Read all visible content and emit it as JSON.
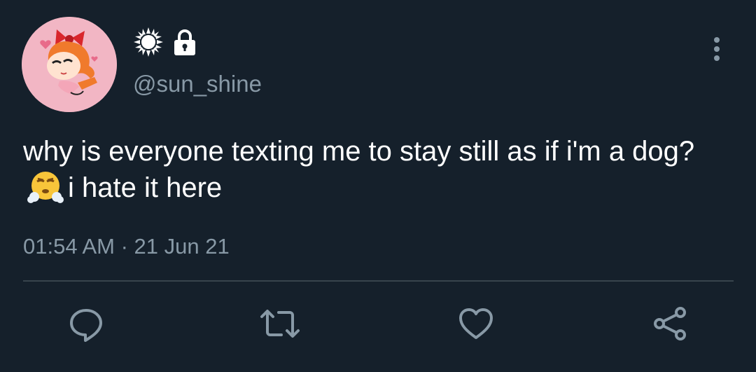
{
  "tweet": {
    "display_name_icons": [
      "sun-icon",
      "lock-icon"
    ],
    "handle": "@sun_shine",
    "text_part1": "why is everyone texting me to stay still as if i'm a dog?",
    "text_part2": "i hate it here",
    "emoji": "face-with-steam-from-nose-emoji",
    "timestamp": "01:54 AM · 21 Jun 21"
  },
  "actions": [
    "reply-icon",
    "retweet-icon",
    "like-icon",
    "share-icon"
  ],
  "colors": {
    "background": "#15202b",
    "text": "#ffffff",
    "muted": "#8899a6",
    "divider": "#38444d",
    "avatar_bg": "#f2b6c4"
  }
}
